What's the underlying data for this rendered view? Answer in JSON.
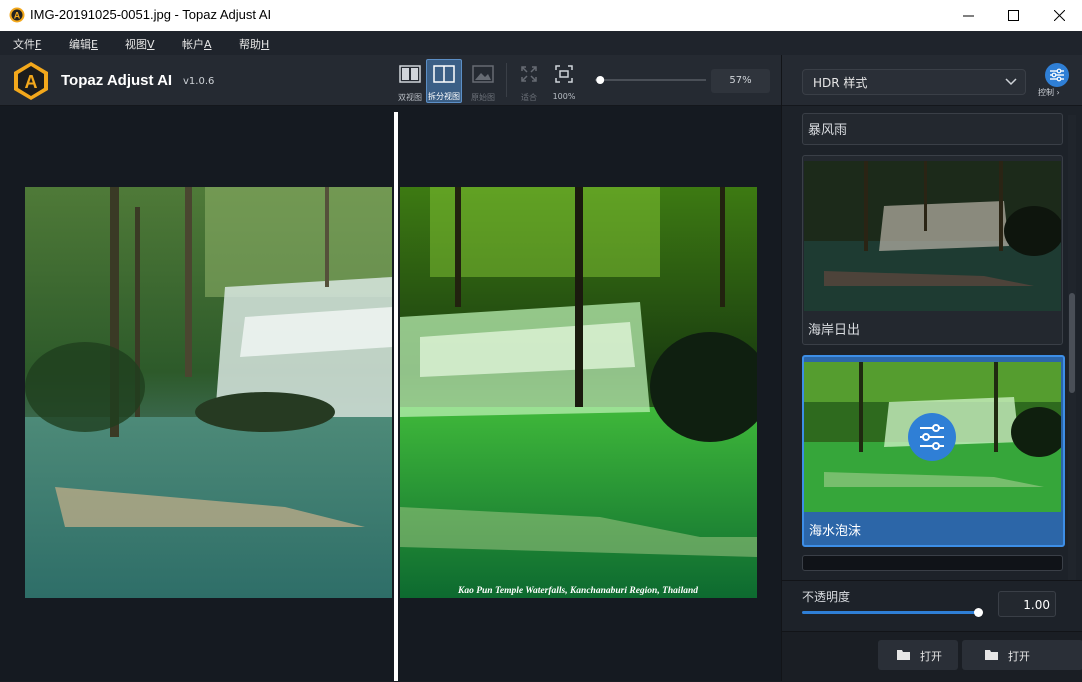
{
  "window": {
    "title": "IMG-20191025-0051.jpg - Topaz Adjust AI"
  },
  "menu": [
    {
      "label": "文件",
      "key": "F"
    },
    {
      "label": "编辑",
      "key": "E"
    },
    {
      "label": "视图",
      "key": "V"
    },
    {
      "label": "帐户",
      "key": "A"
    },
    {
      "label": "帮助",
      "key": "H"
    }
  ],
  "brand": {
    "name": "Topaz Adjust AI",
    "version": "v1.0.6"
  },
  "toolbar": {
    "dual_view": "双视图",
    "split_view": "拆分视图",
    "original": "原始图",
    "fit": "适合",
    "zoom100": "100%",
    "zoom_value": "57%",
    "zoom_level": 0.57
  },
  "image": {
    "caption": "Kao Pun Temple Waterfalls, Kanchanaburi Region, Thailand"
  },
  "right_panel": {
    "style_dropdown": "HDR 样式",
    "controls_label": "控制",
    "presets": [
      {
        "label": "暴风雨"
      },
      {
        "label": "海岸日出"
      },
      {
        "label": "海水泡沫"
      }
    ],
    "opacity_label": "不透明度",
    "opacity_value": "1.00",
    "open_label_1": "打开",
    "open_label_2": "打开"
  },
  "colors": {
    "accent": "#2f7fd6",
    "selected": "#2c66a8",
    "bg": "#1a1e24"
  }
}
